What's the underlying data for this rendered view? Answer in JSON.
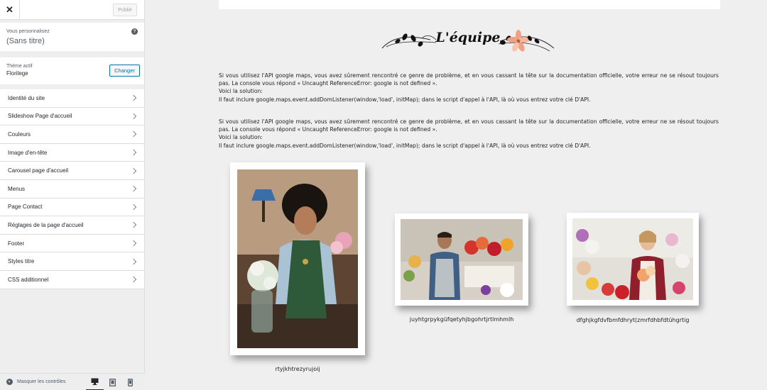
{
  "topbar": {
    "close_label": "✕",
    "publish_label": "Publié"
  },
  "customize": {
    "label": "Vous personnalisez",
    "title": "(Sans titre)"
  },
  "theme": {
    "label": "Thème actif",
    "name": "Florilege",
    "change_label": "Changer"
  },
  "menu": [
    {
      "label": "Identité du site"
    },
    {
      "label": "Slideshow Page d'accueil"
    },
    {
      "label": "Couleurs"
    },
    {
      "label": "Image d'en-tête"
    },
    {
      "label": "Carousel page d'accueil"
    },
    {
      "label": "Menus"
    },
    {
      "label": "Page Contact"
    },
    {
      "label": "Réglages de la page d'accueil"
    },
    {
      "label": "Footer"
    },
    {
      "label": "Styles titre"
    },
    {
      "label": "CSS additionnel"
    }
  ],
  "footer": {
    "hide_label": "Masquer les contrôles"
  },
  "preview": {
    "heading": "L'équipe",
    "paragraphs": [
      {
        "line1": "Si vous utilisez l'API google maps, vous avez sûrement rencontré ce genre de problème, et en vous cassant la tête sur la documentation officielle, votre erreur ne se résout toujours pas. La console vous répond « Uncaught ReferenceError: google is not defined ».",
        "line2": "Voici la solution:",
        "line3": "Il faut inclure google.maps.event.addDomListener(window,'load', initMap); dans le script d'appel à l'API, là où vous entrez votre clé D'API."
      },
      {
        "line1": "Si vous utilisez l'API google maps, vous avez sûrement rencontré ce genre de problème, et en vous cassant la tête sur la documentation officielle, votre erreur ne se résout toujours pas. La console vous répond « Uncaught ReferenceError: google is not defined ».",
        "line2": "Voici la solution:",
        "line3": "Il faut inclure google.maps.event.addDomListener(window,'load', initMap); dans le script d'appel à l'API, là où vous entrez votre clé D'API."
      }
    ],
    "team": [
      {
        "caption": "rtyjkhtrezyrujoij"
      },
      {
        "caption": "juyhtgrpykgüfqetyhjbgohrtjrtlmhmlh"
      },
      {
        "caption": "dfghjkgfdvfbmfdhryt(zmrfdhbfdtühgrtig"
      }
    ]
  },
  "colors": {
    "accent": "#0073aa",
    "sidebar_bg": "#eeeeee",
    "preview_bg": "#efefef"
  }
}
